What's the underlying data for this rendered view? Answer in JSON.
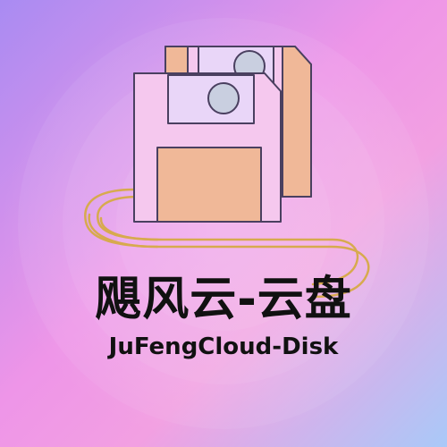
{
  "logo": {
    "title_cn": "飓风云-云盘",
    "title_en": "JuFengCloud-Disk"
  },
  "colors": {
    "background_start": "#a98bf2",
    "background_end": "#a9c9f8",
    "disk_body": "#f5c8ee",
    "disk_shutter": "#f0b898",
    "disk_label": "#e9d6f8",
    "disk_outline": "#4a4060",
    "disk_hub": "#c9cfe0",
    "cable": "#d7aa4e",
    "text": "#111111"
  },
  "icons": [
    "floppy-disk-icon",
    "floppy-disk-icon",
    "cable-icon"
  ]
}
